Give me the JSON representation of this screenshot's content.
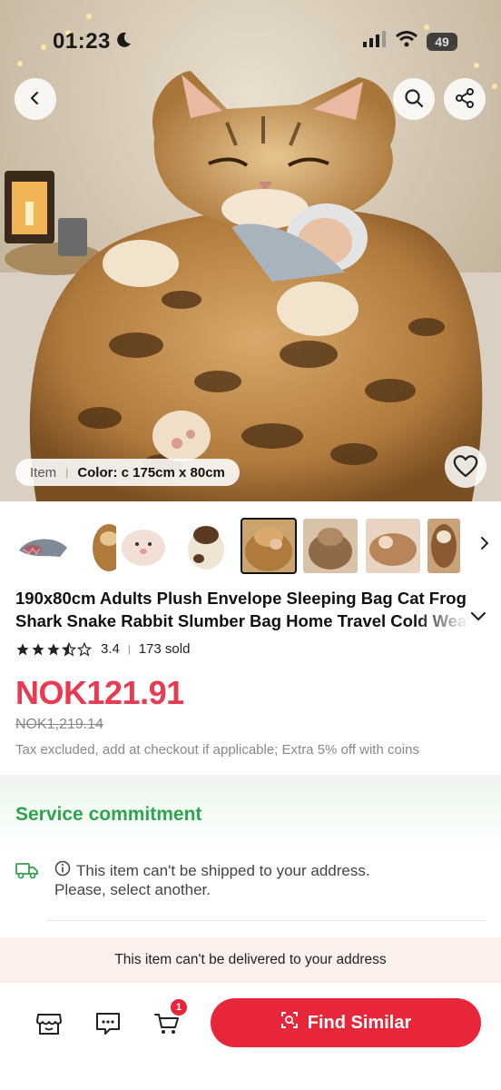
{
  "status_bar": {
    "time": "01:23",
    "battery": "49",
    "icons": [
      "moon-icon",
      "signal-icon",
      "wifi-icon",
      "battery-icon"
    ]
  },
  "header": {
    "icons": [
      "back-arrow-icon",
      "search-icon",
      "share-icon"
    ]
  },
  "hero": {
    "favorite_icon": "heart-outline-icon"
  },
  "variant": {
    "label": "Item",
    "value": "Color: c 175cm x 80cm"
  },
  "thumbnails": {
    "count": 8,
    "selected_index": 4,
    "more_icon": "chevron-right-icon"
  },
  "product": {
    "title_line1": "190x80cm Adults Plush Envelope Sleeping Bag Cat Frog",
    "title_line2": "Shark Snake Rabbit Slumber Bag Home Travel Cold Weather",
    "rating_value": "3.4",
    "rating_stars": 3.5,
    "sold": "173 sold",
    "price": "NOK121.91",
    "original_price": "NOK1,219.14",
    "tax_note": "Tax excluded, add at checkout if applicable; Extra 5% off with coins"
  },
  "service": {
    "title": "Service commitment",
    "shipping_line1": "This item can't be shipped to your address.",
    "shipping_line2": "Please, select another."
  },
  "delivery_banner": "This item can't be delivered to your address",
  "bottom_bar": {
    "cart_count": "1",
    "find_similar_label": "Find Similar",
    "icons": [
      "store-icon",
      "chat-icon",
      "cart-icon",
      "scan-icon"
    ]
  },
  "colors": {
    "accent_red": "#e8263a",
    "price_red": "#e83a50",
    "service_green": "#2ea44f",
    "banner_bg": "#fdf0ec"
  }
}
